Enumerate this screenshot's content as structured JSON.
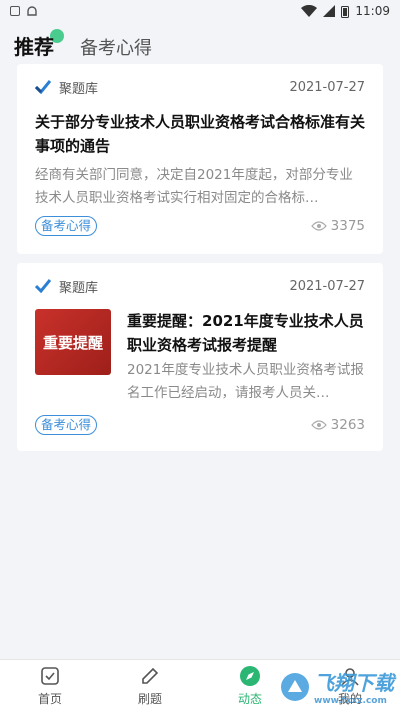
{
  "status_bar": {
    "left_icons": [
      "notification-icon",
      "android-icon"
    ],
    "time": "11:09"
  },
  "tabs": {
    "active": "推荐",
    "other": "备考心得"
  },
  "articles": [
    {
      "source": "聚题库",
      "date": "2021-07-27",
      "title": "关于部分专业技术人员职业资格考试合格标准有关事项的通告",
      "summary": "经商有关部门同意，决定自2021年度起，对部分专业技术人员职业资格考试实行相对固定的合格标…",
      "tag": "备考心得",
      "views": "3375"
    },
    {
      "source": "聚题库",
      "date": "2021-07-27",
      "thumb_text": "重要提醒",
      "title": "重要提醒：2021年度专业技术人员职业资格考试报考提醒",
      "summary": "2021年度专业技术人员职业资格考试报名工作已经启动，请报考人员关…",
      "tag": "备考心得",
      "views": "3263"
    }
  ],
  "tabbar": {
    "items": [
      {
        "label": "首页",
        "icon": "home-icon"
      },
      {
        "label": "刷题",
        "icon": "pencil-icon"
      },
      {
        "label": "动态",
        "icon": "compass-icon"
      },
      {
        "label": "我的",
        "icon": "user-icon"
      }
    ],
    "active": "动态"
  },
  "watermark": {
    "text": "飞翔下载",
    "url": "www.fxxz.com"
  },
  "colors": {
    "accent": "#2bb673",
    "tag_blue": "#3d8fd9"
  }
}
